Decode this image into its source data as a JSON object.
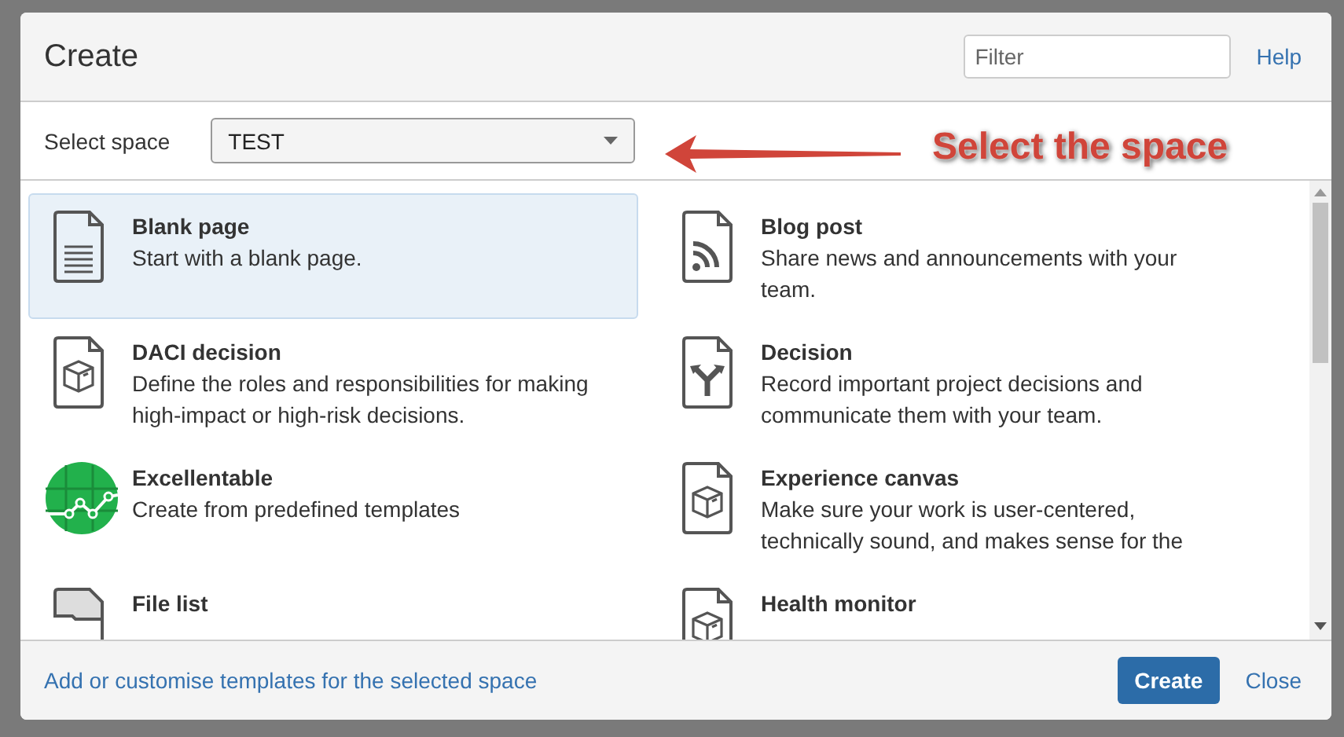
{
  "dialog": {
    "title": "Create",
    "filter": {
      "placeholder": "Filter"
    },
    "help_link": "Help"
  },
  "space_select": {
    "label": "Select space",
    "value": "TEST"
  },
  "annotation": {
    "text": "Select the space"
  },
  "templates": [
    {
      "title": "Blank page",
      "description": "Start with a blank page.",
      "kind": "page",
      "selected": true
    },
    {
      "title": "Blog post",
      "description": "Share news and announcements with your team.",
      "kind": "rss",
      "selected": false
    },
    {
      "title": "DACI decision",
      "description": "Define the roles and responsibilities for making high-impact or high-risk decisions.",
      "kind": "cube",
      "selected": false
    },
    {
      "title": "Decision",
      "description": "Record important project decisions and communicate them with your team.",
      "kind": "fork",
      "selected": false
    },
    {
      "title": "Excellentable",
      "description": "Create from predefined templates",
      "kind": "sheet",
      "selected": false
    },
    {
      "title": "Experience canvas",
      "description": "Make sure your work is user-centered, technically sound, and makes sense for the",
      "kind": "cube",
      "selected": false
    },
    {
      "title": "File list",
      "kind": "folder",
      "selected": false
    },
    {
      "title": "Health monitor",
      "kind": "cube",
      "selected": false
    }
  ],
  "footer": {
    "link": "Add or customise templates for the selected space",
    "primary_button": "Create",
    "close_link": "Close"
  }
}
